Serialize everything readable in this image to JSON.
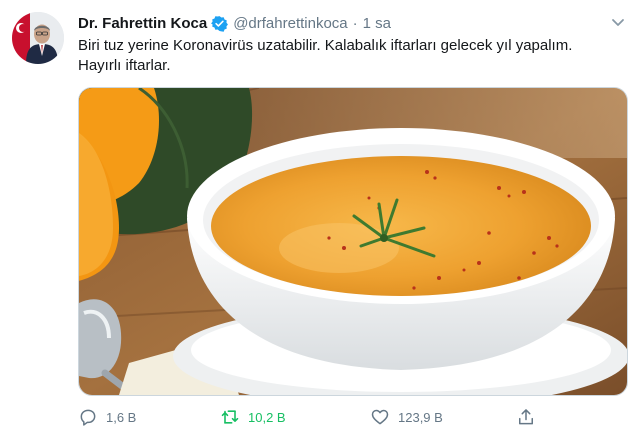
{
  "tweet": {
    "author": {
      "display_name": "Dr. Fahrettin Koca",
      "handle": "@drfahrettinkoca",
      "verified": true
    },
    "separator": "·",
    "time": "1 sa",
    "text_lines": [
      "Biri tuz yerine Koronavirüs uzatabilir. Kalabalık iftarları gelecek yıl yapalım.",
      "Hayırlı iftarlar."
    ],
    "media": {
      "icon": "soup-bowl-photo"
    },
    "actions": {
      "reply_count": "1,6 B",
      "retweet_count": "10,2 B",
      "like_count": "123,9 B"
    }
  },
  "colors": {
    "text": "#14171a",
    "secondary": "#657786",
    "verified": "#1da1f2",
    "retweet_active": "#17bf63"
  }
}
